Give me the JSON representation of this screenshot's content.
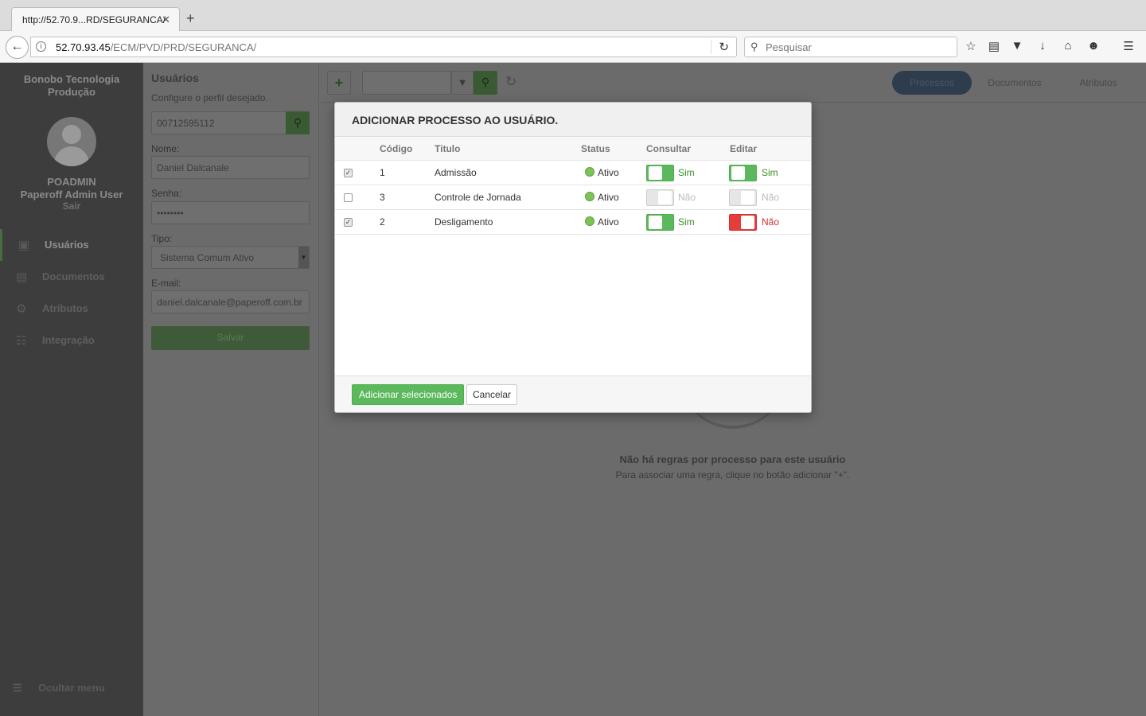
{
  "browser": {
    "tab_title": "http://52.70.9...RD/SEGURANCA/",
    "tab_close": "✕",
    "new_tab": "+",
    "url_host": "52.70.93.45",
    "url_path": "/ECM/PVD/PRD/SEGURANCA/",
    "search_placeholder": "Pesquisar"
  },
  "sidebar": {
    "org_line1": "Bonobo Tecnologia",
    "org_line2": "Produção",
    "user_login": "POADMIN",
    "user_fullname": "Paperoff Admin User",
    "logout": "Sair",
    "items": [
      {
        "label": "Usuários",
        "icon": "lock-icon"
      },
      {
        "label": "Documentos",
        "icon": "document-icon"
      },
      {
        "label": "Atributos",
        "icon": "gear-icon"
      },
      {
        "label": "Integração",
        "icon": "scroll-icon"
      }
    ],
    "hide_menu": "Ocultar menu"
  },
  "form": {
    "title": "Usuários",
    "subtitle": "Configure o perfil desejado.",
    "cpf_value": "00712595112",
    "name_label": "Nome:",
    "name_value": "Daniel Dalcanale",
    "password_label": "Senha:",
    "password_value": "••••••••",
    "type_label": "Tipo:",
    "type_value": "Sistema Comum Ativo",
    "email_label": "E-mail:",
    "email_value": "daniel.dalcanale@paperoff.com.br",
    "save_label": "Salvar"
  },
  "main": {
    "tabs": [
      {
        "label": "Processos",
        "active": true
      },
      {
        "label": "Documentos",
        "active": false
      },
      {
        "label": "Atributos",
        "active": false
      }
    ],
    "empty_title": "Não há regras por processo para este usuário",
    "empty_subtitle": "Para associar uma regra, clique no botão adicionar \"+\"."
  },
  "modal": {
    "title": "ADICIONAR PROCESSO AO USUÁRIO.",
    "columns": [
      "Código",
      "Titulo",
      "Status",
      "Consultar",
      "Editar"
    ],
    "rows": [
      {
        "checked": true,
        "code": "1",
        "title": "Admissão",
        "status": "Ativo",
        "consultar": "Sim",
        "editar": "Sim"
      },
      {
        "checked": false,
        "code": "3",
        "title": "Controle de Jornada",
        "status": "Ativo",
        "consultar": "Não",
        "editar": "Não"
      },
      {
        "checked": true,
        "code": "2",
        "title": "Desligamento",
        "status": "Ativo",
        "consultar": "Sim",
        "editar": "Não"
      }
    ],
    "add_selected_label": "Adicionar selecionados",
    "cancel_label": "Cancelar"
  },
  "colors": {
    "accent_green": "#5cb85c",
    "danger_red": "#e53c3c",
    "status_active": "#7cc35a"
  }
}
